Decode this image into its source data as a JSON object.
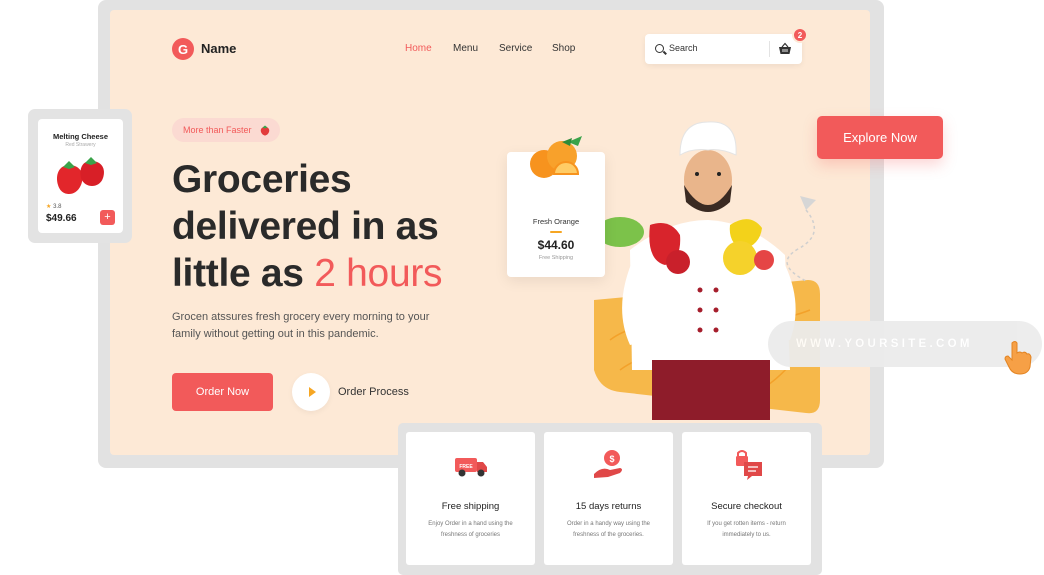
{
  "header": {
    "logo_letter": "G",
    "brand": "Name",
    "nav": [
      "Home",
      "Menu",
      "Service",
      "Shop"
    ],
    "search_placeholder": "Search",
    "cart_count": "2"
  },
  "hero": {
    "tag": "More than Faster",
    "headline_line1": "Groceries",
    "headline_line2": "delivered in as",
    "headline_line3_prefix": "little as ",
    "headline_accent": "2 hours",
    "description": "Grocen atssures fresh grocery every morning to your family without getting out in this pandemic.",
    "order_button": "Order Now",
    "process_label": "Order Process"
  },
  "orange_card": {
    "title": "Fresh Orange",
    "price": "$44.60",
    "subtitle": "Free Shipping"
  },
  "cheese_card": {
    "title": "Melting Cheese",
    "subtitle": "Red Strawery",
    "rating": "3.8",
    "price": "$49.66",
    "add": "+"
  },
  "explore_button": "Explore Now",
  "url_text": "WWW.YOURSITE.COM",
  "features": [
    {
      "title": "Free shipping",
      "description": "Enjoy Order in a hand using the freshness of groceries",
      "icon": "truck-icon",
      "badge": "FREE"
    },
    {
      "title": "15 days returns",
      "description": "Order in a handy way using the freshness of the groceries.",
      "icon": "money-hand-icon"
    },
    {
      "title": "Secure checkout",
      "description": "If you get rotten items - return immediately to us.",
      "icon": "secure-chat-icon"
    }
  ],
  "colors": {
    "accent": "#f25a5a",
    "hero_bg": "#fde9d6",
    "yellow": "#f6a623"
  }
}
